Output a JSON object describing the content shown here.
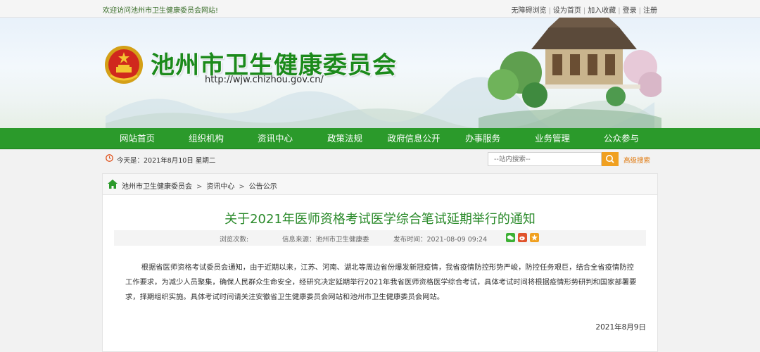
{
  "topbar": {
    "welcome": "欢迎访问池州市卫生健康委员会网站!",
    "links": [
      "无障碍浏览",
      "设为首页",
      "加入收藏",
      "登录",
      "注册"
    ],
    "separator": "|"
  },
  "header": {
    "title": "池州市卫生健康委员会",
    "url": "http://wjw.chizhou.gov.cn/"
  },
  "nav": {
    "items": [
      "网站首页",
      "组织机构",
      "资讯中心",
      "政策法规",
      "政府信息公开",
      "办事服务",
      "业务管理",
      "公众参与"
    ]
  },
  "date_bar": {
    "today": "今天是：2021年8月10日 星期二",
    "search_placeholder": "--站内搜索--",
    "advanced_search": "高级搜索"
  },
  "breadcrumb": {
    "items": [
      "池州市卫生健康委员会",
      "资讯中心",
      "公告公示"
    ],
    "separator": ">"
  },
  "article": {
    "title": "关于2021年医师资格考试医学综合笔试延期举行的通知",
    "views_label": "浏览次数:",
    "source": "信息来源：池州市卫生健康委",
    "publish_time": "发布时间：2021-08-09 09:24",
    "body": "根据省医师资格考试委员会通知，由于近期以来，江苏、河南、湖北等周边省份爆发新冠疫情，我省疫情防控形势严峻，防控任务艰巨，结合全省疫情防控工作要求，为减少人员聚集，确保人民群众生命安全，经研究决定延期举行2021年我省医师资格医学综合考试，具体考试时间将根据疫情形势研判和国家部署要求，择期组织实施。具体考试时间请关注安徽省卫生健康委员会网站和池州市卫生健康委员会网站。",
    "sign_date": "2021年8月9日"
  },
  "colors": {
    "brand_green": "#2b9a2b",
    "title_green": "#1b8a1b",
    "search_orange": "#f0a020"
  },
  "icons": [
    "national-emblem-icon",
    "clock-icon",
    "search-icon",
    "home-icon",
    "wechat-icon",
    "weibo-icon",
    "favorite-icon"
  ]
}
